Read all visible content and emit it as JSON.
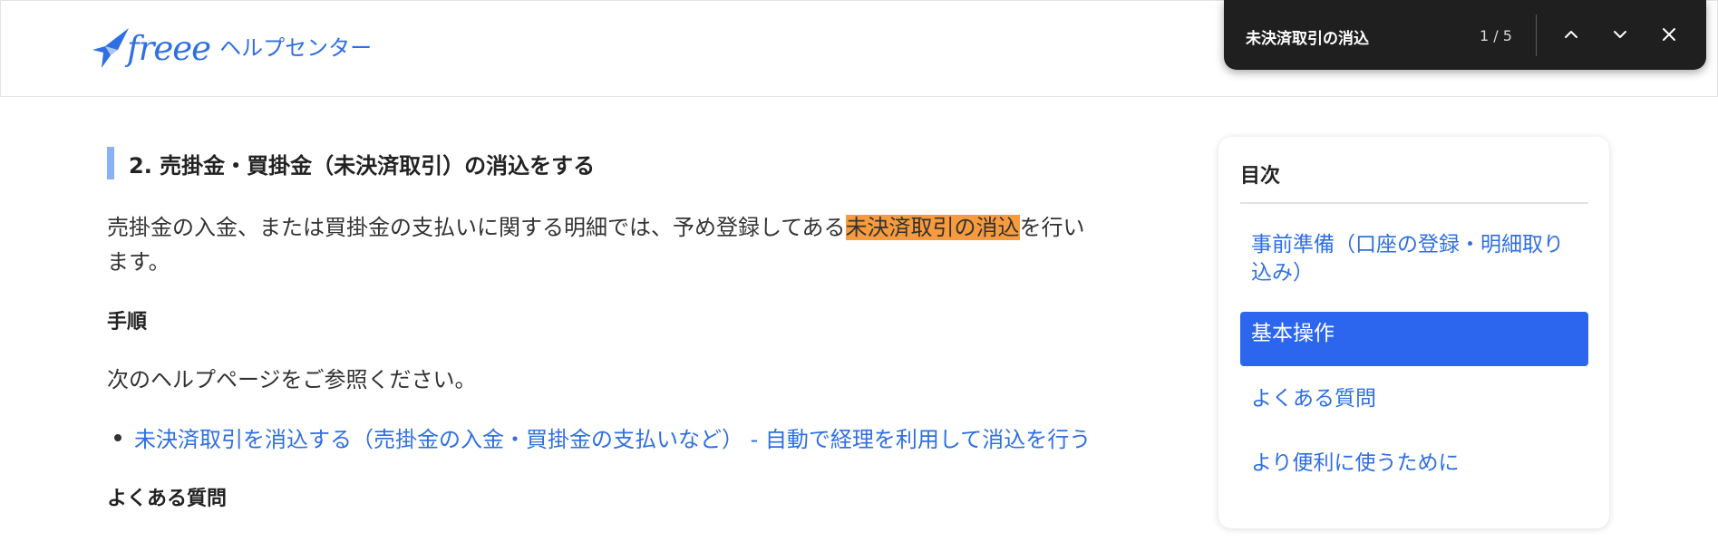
{
  "header": {
    "logo_brand": "freee",
    "logo_suffix": "ヘルプセンター",
    "colors": {
      "brand": "#2f6fe2"
    }
  },
  "find_bar": {
    "query": "未決済取引の消込",
    "match_count": "1 / 5",
    "icons": {
      "previous": "chevron-up-icon",
      "next": "chevron-down-icon",
      "close": "close-icon"
    }
  },
  "article": {
    "section_heading": "2. 売掛金・買掛金（未決済取引）の消込をする",
    "paragraph": {
      "before_highlight": "売掛金の入金、または買掛金の支払いに関する明細では、予め登録してある",
      "highlight": "未決済取引の消込",
      "after_highlight": "を行います。"
    },
    "steps_heading": "手順",
    "reference_text": "次のヘルプページをご参照ください。",
    "links": [
      {
        "label": "未決済取引を消込する（売掛金の入金・買掛金の支払いなど） - 自動で経理を利用して消込を行う"
      }
    ],
    "faq_heading": "よくある質問",
    "colors": {
      "highlight": "#f79b3e",
      "heading_bar": "#8ab0f5",
      "link": "#2f6fe2"
    }
  },
  "toc": {
    "title": "目次",
    "items": [
      {
        "label": "事前準備（口座の登録・明細取り込み）",
        "active": false
      },
      {
        "label": "基本操作",
        "active": true
      },
      {
        "label": "よくある質問",
        "active": false
      },
      {
        "label": "より便利に使うために",
        "active": false
      }
    ],
    "colors": {
      "active_bg": "#2d66ee",
      "active_text": "#ffffff"
    }
  }
}
